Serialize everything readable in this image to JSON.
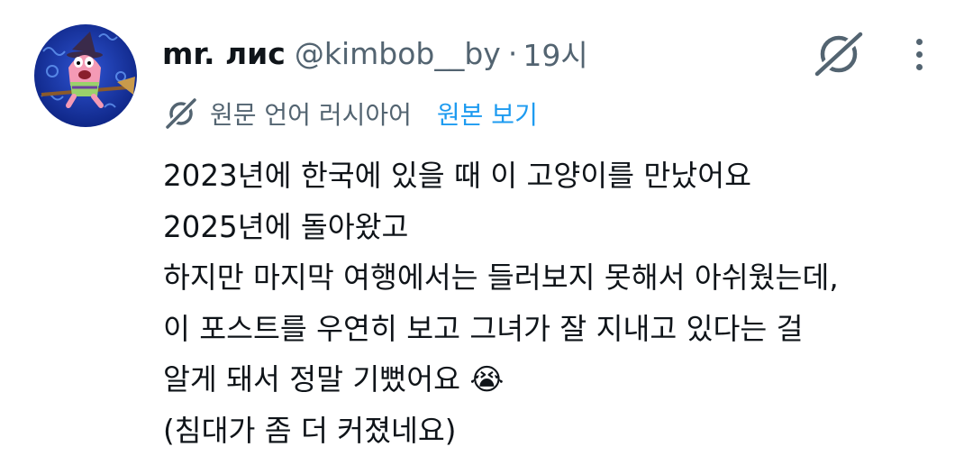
{
  "post": {
    "display_name": "mr. лис",
    "handle": "@kimbob__by",
    "separator": "·",
    "time": "19시",
    "translation_note": "원문 언어 러시아어",
    "show_original_label": "원본 보기",
    "lines": [
      "2023년에 한국에 있을 때 이 고양이를 만났어요",
      "2025년에 돌아왔고",
      "하지만 마지막 여행에서는 들러보지 못해서 아쉬웠는데,",
      "이 포스트를 우연히 보고 그녀가 잘 지내고 있다는 걸",
      "알게 돼서 정말 기뻤어요",
      "(침대가 좀 더 커졌네요)"
    ],
    "emoji": "😭"
  },
  "icons": {
    "avatar": "patrick-star-witch-broom-avatar",
    "grok": "grok-icon",
    "translate": "grok-translate-icon",
    "more": "more-vertical-icon"
  },
  "colors": {
    "text": "#0f1419",
    "secondary": "#536471",
    "link": "#1d9bf0",
    "avatar_bg": "#1e3aa8"
  }
}
